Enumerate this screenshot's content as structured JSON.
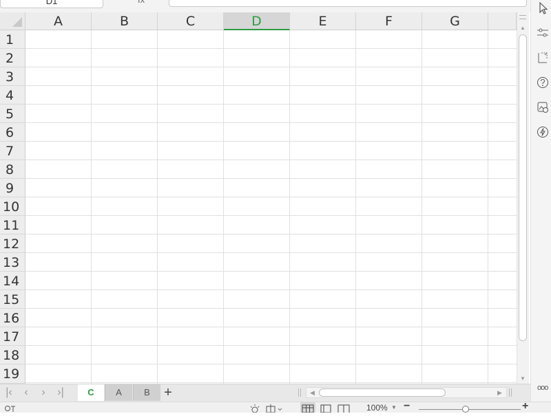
{
  "formula_bar": {
    "name_box": "D1",
    "fx_label": "fx",
    "formula_value": ""
  },
  "grid": {
    "columns": [
      {
        "label": "A"
      },
      {
        "label": "B"
      },
      {
        "label": "C"
      },
      {
        "label": "D"
      },
      {
        "label": "E"
      },
      {
        "label": "F"
      },
      {
        "label": "G"
      }
    ],
    "active_column": "D",
    "rows": [
      "1",
      "2",
      "3",
      "4",
      "5",
      "6",
      "7",
      "8",
      "9",
      "10",
      "11",
      "12",
      "13",
      "14",
      "15",
      "16",
      "17",
      "18",
      "19"
    ]
  },
  "sheet_tabs": {
    "tabs": [
      {
        "label": "C",
        "active": true
      },
      {
        "label": "A",
        "active": false
      },
      {
        "label": "B",
        "active": false
      }
    ],
    "add_label": "+"
  },
  "status_bar": {
    "zoom_level": "100%",
    "zoom_out_label": "−",
    "zoom_in_label": "+"
  },
  "sidebar": {
    "icons": [
      "cursor-icon",
      "filter-settings-icon",
      "transform-icon",
      "help-icon",
      "image-edit-icon",
      "lightning-icon"
    ],
    "more_label": "ooo"
  },
  "colors": {
    "accent": "#2e9a43",
    "header_bg": "#ededed",
    "grid_line": "#e0e0e0"
  }
}
